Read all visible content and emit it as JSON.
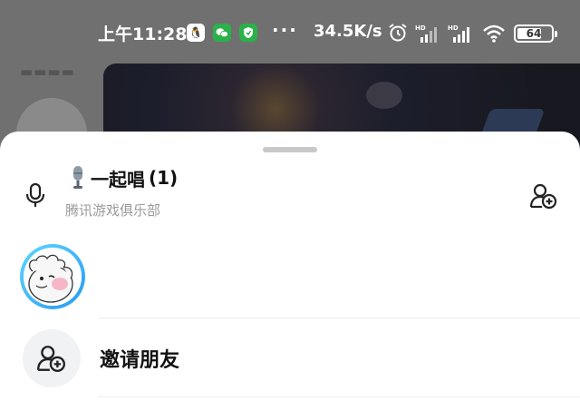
{
  "status_bar": {
    "time": "上午11:28",
    "speed": "34.5K/s",
    "battery": "64",
    "dots": "···",
    "icons": [
      "qq-icon",
      "wechat-icon",
      "shield-icon",
      "alarm-icon",
      "signal-hd-icon",
      "signal-hd-icon",
      "wifi-icon",
      "battery-icon"
    ]
  },
  "room": {
    "title": "一起唱",
    "count": "(1)",
    "subtitle": "腾讯游戏俱乐部"
  },
  "members": [
    {
      "avatar": "cartoon-dog-avatar"
    }
  ],
  "invite": {
    "label": "邀请朋友",
    "icon": "add-user-icon"
  },
  "colors": {
    "avatar_ring": "#2a9af0",
    "subtitle": "#9a9a9a",
    "invite_bg": "#f1f2f4"
  }
}
